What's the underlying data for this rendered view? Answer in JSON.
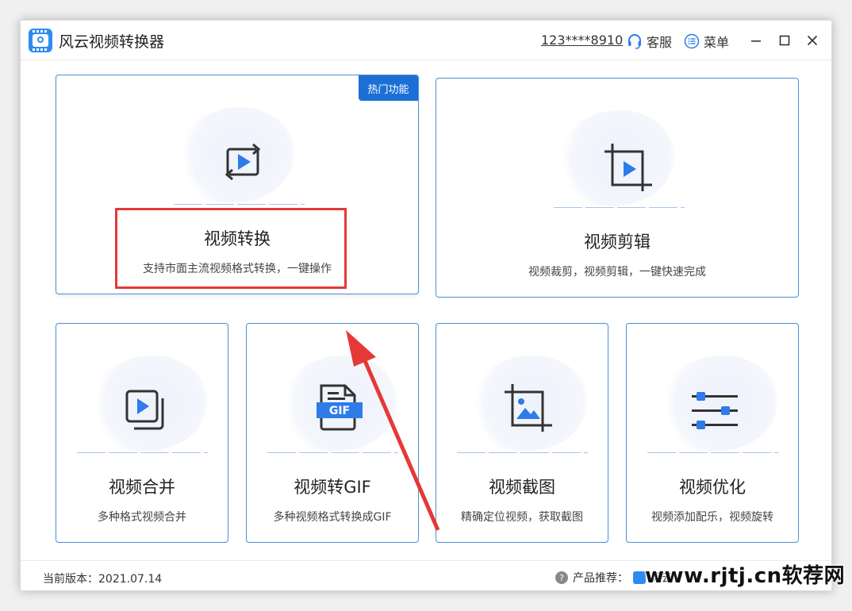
{
  "titlebar": {
    "app_title": "风云视频转换器",
    "account": "123****8910",
    "service_label": "客服",
    "menu_label": "菜单"
  },
  "cards": {
    "convert": {
      "title": "视频转换",
      "desc": "支持市面主流视频格式转换，一键操作",
      "badge": "热门功能"
    },
    "edit": {
      "title": "视频剪辑",
      "desc": "视频裁剪，视频剪辑，一键快速完成"
    },
    "merge": {
      "title": "视频合并",
      "desc": "多种格式视频合并"
    },
    "gif": {
      "title": "视频转GIF",
      "desc": "多种视频格式转换成GIF",
      "icon_text": "GIF"
    },
    "screenshot": {
      "title": "视频截图",
      "desc": "精确定位视频，获取截图"
    },
    "optimize": {
      "title": "视频优化",
      "desc": "视频添加配乐，视频旋转"
    }
  },
  "footer": {
    "version": "当前版本：2021.07.14",
    "recommend_label": "产品推荐：",
    "recommend_item": "风云"
  },
  "watermark": "www.rjtj.cn软荐网",
  "colors": {
    "accent": "#1c6fd6",
    "icon_blue": "#2e7bea",
    "highlight": "#e53935"
  }
}
